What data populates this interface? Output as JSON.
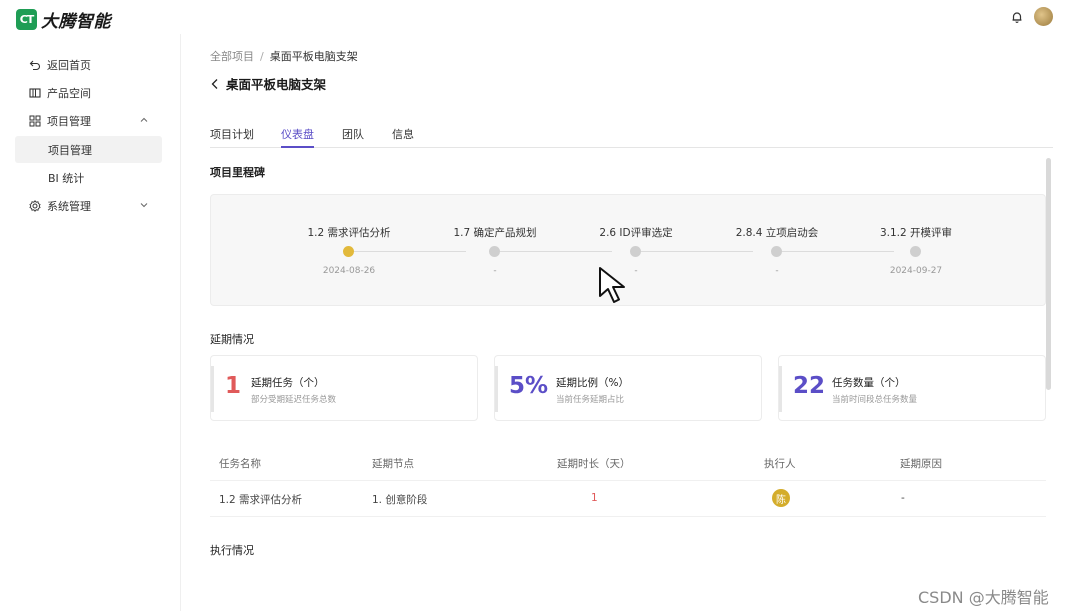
{
  "app": {
    "logo_mark": "CT",
    "logo_text": "大腾智能"
  },
  "topbar": {
    "icons": [
      "bell-icon",
      "avatar"
    ]
  },
  "sidebar": {
    "items": [
      {
        "label": "返回首页",
        "icon": "return-icon"
      },
      {
        "label": "产品空间",
        "icon": "product-space-icon"
      },
      {
        "label": "项目管理",
        "icon": "grid-icon",
        "expanded": true
      },
      {
        "label": "项目管理",
        "sub": true,
        "active": true
      },
      {
        "label": "BI 统计",
        "sub": true
      },
      {
        "label": "系统管理",
        "icon": "gear-icon",
        "expanded": false
      }
    ]
  },
  "breadcrumb": {
    "root": "全部项目",
    "separator": "/",
    "current": "桌面平板电脑支架"
  },
  "page": {
    "title": "桌面平板电脑支架"
  },
  "tabs": [
    {
      "label": "项目计划",
      "active": false
    },
    {
      "label": "仪表盘",
      "active": true
    },
    {
      "label": "团队",
      "active": false
    },
    {
      "label": "信息",
      "active": false
    }
  ],
  "milestone_section": {
    "title": "项目里程碑",
    "milestones": [
      {
        "label": "1.2 需求评估分析",
        "date": "2024-08-26",
        "done": true
      },
      {
        "label": "1.7 确定产品规划",
        "date": "-",
        "done": false
      },
      {
        "label": "2.6 ID评审选定",
        "date": "-",
        "done": false
      },
      {
        "label": "2.8.4 立项启动会",
        "date": "-",
        "done": false
      },
      {
        "label": "3.1.2 开模评审",
        "date": "2024-09-27",
        "done": false
      }
    ]
  },
  "delay_section": {
    "title": "延期情况",
    "cards": [
      {
        "value": "1",
        "title": "延期任务（个）",
        "desc": "部分受期延迟任务总数",
        "color": "#e05a5a"
      },
      {
        "value": "5%",
        "title": "延期比例（%）",
        "desc": "当前任务延期占比",
        "color": "#5b4ec7"
      },
      {
        "value": "22",
        "title": "任务数量（个）",
        "desc": "当前时间段总任务数量",
        "color": "#5b4ec7"
      }
    ],
    "table": {
      "headers": [
        "任务名称",
        "延期节点",
        "延期时长（天）",
        "执行人",
        "延期原因"
      ],
      "rows": [
        {
          "name": "1.2 需求评估分析",
          "node": "1. 创意阶段",
          "days": "1",
          "assignee": "陈",
          "reason": "-"
        }
      ]
    }
  },
  "execution_section": {
    "title": "执行情况"
  },
  "watermark": "CSDN @大腾智能",
  "colors": {
    "accent": "#5b4ec7",
    "milestone_done": "#e2b93b",
    "brand_green": "#1f9d55",
    "delay_red": "#e05a5a"
  }
}
